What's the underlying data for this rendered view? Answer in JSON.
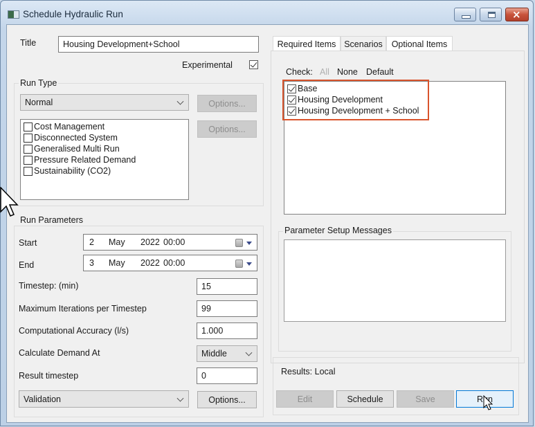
{
  "window": {
    "title": "Schedule Hydraulic Run",
    "controls": {
      "minimize": "minimize",
      "maximize": "maximize",
      "close": "×"
    }
  },
  "general": {
    "title_label": "Title",
    "title_value": "Housing Development+School",
    "experimental_label": "Experimental",
    "experimental_checked": true
  },
  "run_type": {
    "group_label": "Run Type",
    "selected": "Normal",
    "options_button_1": "Options...",
    "options_button_2": "Options...",
    "items": [
      {
        "label": "Cost Management",
        "checked": false
      },
      {
        "label": "Disconnected System",
        "checked": false
      },
      {
        "label": "Generalised Multi Run",
        "checked": false
      },
      {
        "label": "Pressure Related Demand",
        "checked": false
      },
      {
        "label": "Sustainability (CO2)",
        "checked": false
      }
    ]
  },
  "run_parameters": {
    "group_label": "Run Parameters",
    "start_label": "Start",
    "start": {
      "day": "2",
      "month": "May",
      "year": "2022",
      "time": "00:00"
    },
    "end_label": "End",
    "end": {
      "day": "3",
      "month": "May",
      "year": "2022",
      "time": "00:00"
    },
    "timestep_label": "Timestep: (min)",
    "timestep_value": "15",
    "max_iterations_label": "Maximum Iterations per Timestep",
    "max_iterations_value": "99",
    "accuracy_label": "Computational Accuracy (l/s)",
    "accuracy_value": "1.000",
    "demand_label": "Calculate Demand At",
    "demand_value": "Middle",
    "result_timestep_label": "Result timestep",
    "result_timestep_value": "0",
    "validation_value": "Validation",
    "validation_options_button": "Options..."
  },
  "tabs": [
    {
      "label": "Required Items",
      "active": false
    },
    {
      "label": "Scenarios",
      "active": true
    },
    {
      "label": "Optional Items",
      "active": false
    }
  ],
  "scenarios": {
    "check_label": "Check:",
    "check_all": "All",
    "check_none": "None",
    "check_default": "Default",
    "items": [
      {
        "label": "Base",
        "checked": true
      },
      {
        "label": "Housing Development",
        "checked": true
      },
      {
        "label": "Housing Development + School",
        "checked": true
      }
    ],
    "highlight_color": "#d9542c"
  },
  "messages": {
    "group_label": "Parameter Setup Messages",
    "content": ""
  },
  "results": {
    "label": "Results: Local",
    "edit_button": "Edit",
    "schedule_button": "Schedule",
    "save_button": "Save",
    "run_button": "Run"
  }
}
